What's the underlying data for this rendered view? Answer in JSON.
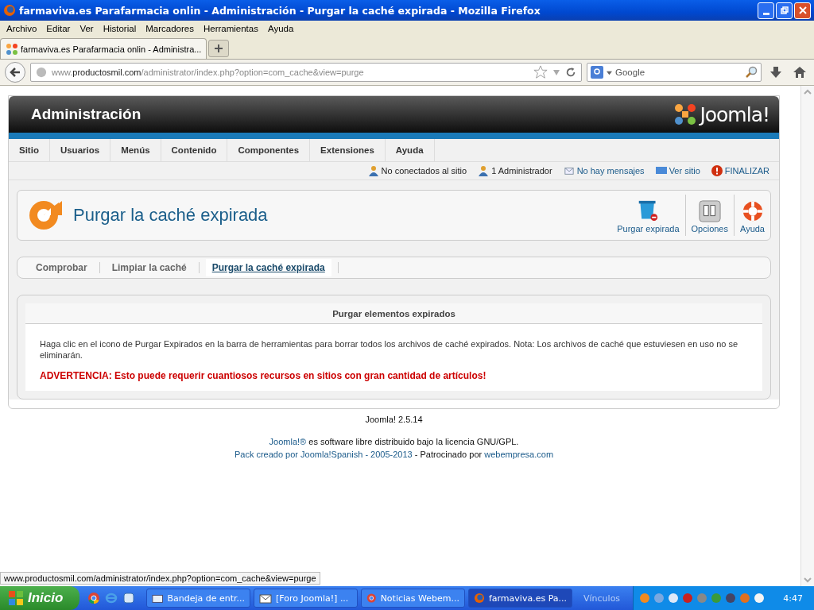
{
  "window": {
    "title": "farmaviva.es Parafarmacia onlin - Administración - Purgar la caché expirada - Mozilla Firefox"
  },
  "menu_bar": [
    "Archivo",
    "Editar",
    "Ver",
    "Historial",
    "Marcadores",
    "Herramientas",
    "Ayuda"
  ],
  "browser_tabs": [
    {
      "label": "farmaviva.es Parafarmacia onlin - Administra...",
      "selected": true
    }
  ],
  "address_bar": {
    "url": "www.**productosmil.com**/administrator/index.php?option=com_cache&view=purge"
  },
  "search_field": {
    "placeholder": "Google"
  },
  "admin": {
    "header_title": "Administración",
    "logo_text": "Joomla!"
  },
  "main_menu": [
    "Sitio",
    "Usuarios",
    "Menús",
    "Contenido",
    "Componentes",
    "Extensiones",
    "Ayuda"
  ],
  "status_links": [
    {
      "kind": "online",
      "label": "No conectados al sitio"
    },
    {
      "kind": "admins",
      "label": "1 Administrador"
    },
    {
      "kind": "messages",
      "label": "No hay mensajes"
    },
    {
      "kind": "site",
      "label": "Ver sitio"
    },
    {
      "kind": "logout",
      "label": "FINALIZAR"
    }
  ],
  "page_title": "Purgar la caché expirada",
  "toolbar": [
    {
      "kind": "purge",
      "label": "Purgar expirada"
    },
    {
      "kind": "options",
      "label": "Opciones"
    },
    {
      "kind": "help",
      "label": "Ayuda"
    }
  ],
  "submenu": [
    {
      "label": "Comprobar",
      "selected": false
    },
    {
      "label": "Limpiar la caché",
      "selected": false
    },
    {
      "label": "Purgar la caché expirada",
      "selected": true
    }
  ],
  "panel": {
    "heading": "Purgar elementos expirados",
    "description": "Haga clic en el icono de Purgar Expirados en la barra de herramientas para borrar todos los archivos de caché expirados. Nota: Los archivos de caché que estuviesen en uso no se eliminarán.",
    "warning": "ADVERTENCIA: Esto puede requerir cuantiosos recursos en sitios con gran cantidad de artículos!"
  },
  "footer": {
    "version": "Joomla! 2.5.14",
    "license_link": "Joomla!®",
    "license_text": "es software libre distribuido bajo la licencia GNU/GPL.",
    "pack_link": "Pack creado por Joomla!Spanish - 2005-2013",
    "sponsor_text": "- Patrocinado por",
    "sponsor_link": "webempresa.com"
  },
  "status_bar": {
    "url": "www.productosmil.com/administrator/index.php?option=com_cache&view=purge"
  },
  "taskbar": {
    "start": "Inicio",
    "tasks": [
      {
        "kind": "mail",
        "label": "Bandeja de entr...",
        "selected": false
      },
      {
        "kind": "envelope",
        "label": "[Foro Joomla!] ...",
        "selected": false
      },
      {
        "kind": "chrome",
        "label": "Noticias Webem...",
        "selected": false
      },
      {
        "kind": "firefox",
        "label": "farmaviva.es Pa...",
        "selected": true
      }
    ],
    "links_label": "Vínculos",
    "clock": "4:47"
  }
}
